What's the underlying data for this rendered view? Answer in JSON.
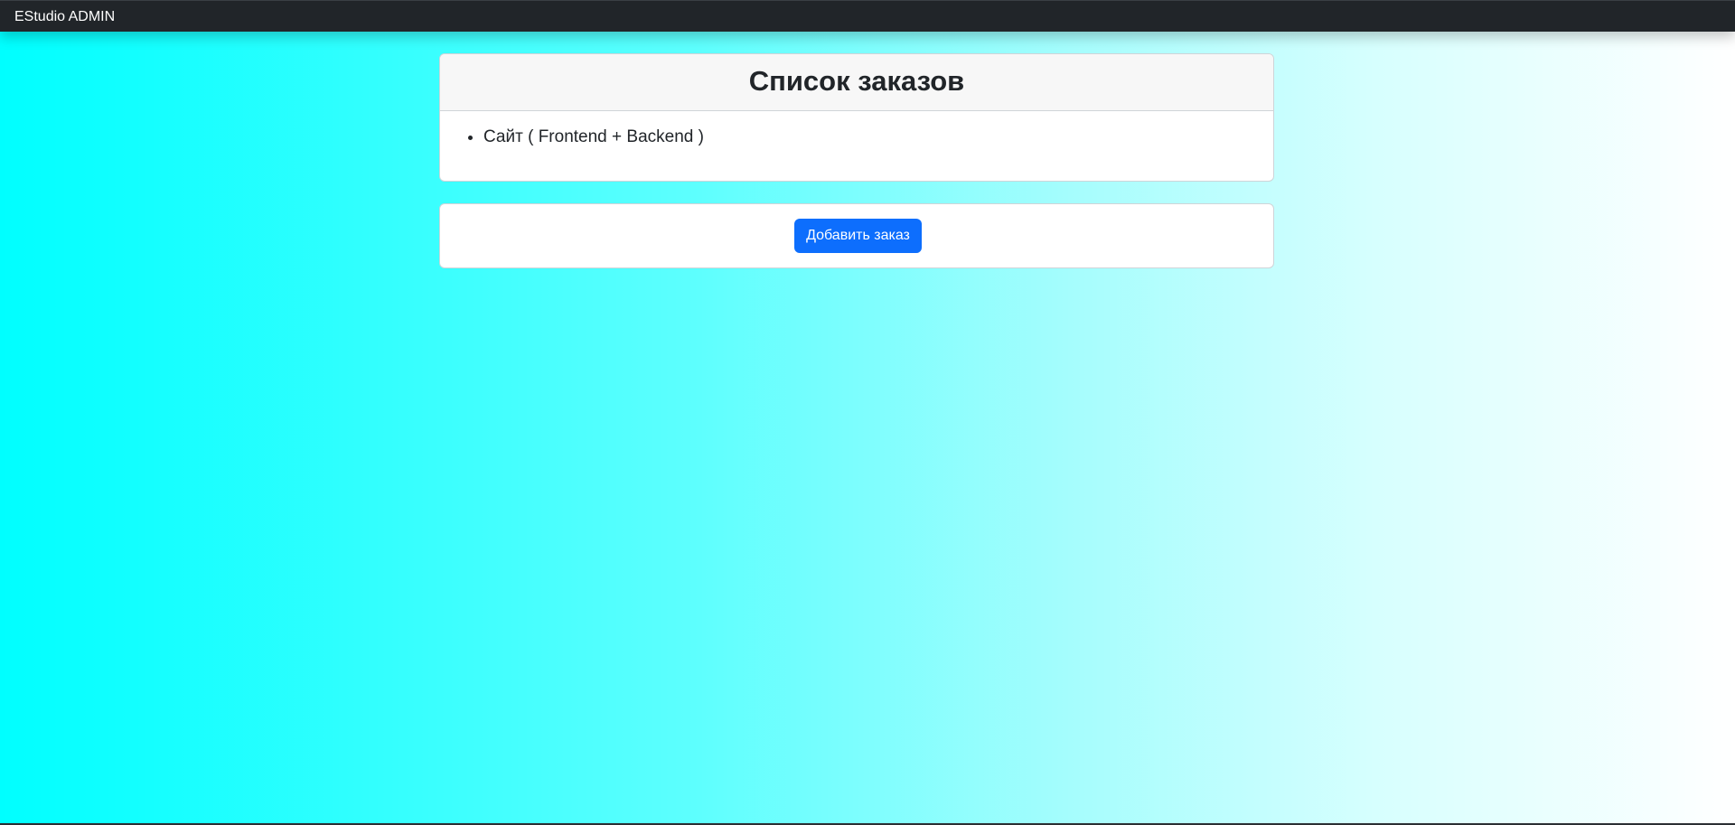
{
  "navbar": {
    "brand": "EStudio ADMIN",
    "background_color": "#212529"
  },
  "orders": {
    "title": "Список заказов",
    "items": [
      {
        "label": "Сайт ( Frontend + Backend )"
      }
    ]
  },
  "actions": {
    "add_order_label": "Добавить заказ",
    "button_color": "#0d6efd"
  },
  "background": {
    "gradient_start": "#00ffff",
    "gradient_end": "#ffffff"
  }
}
